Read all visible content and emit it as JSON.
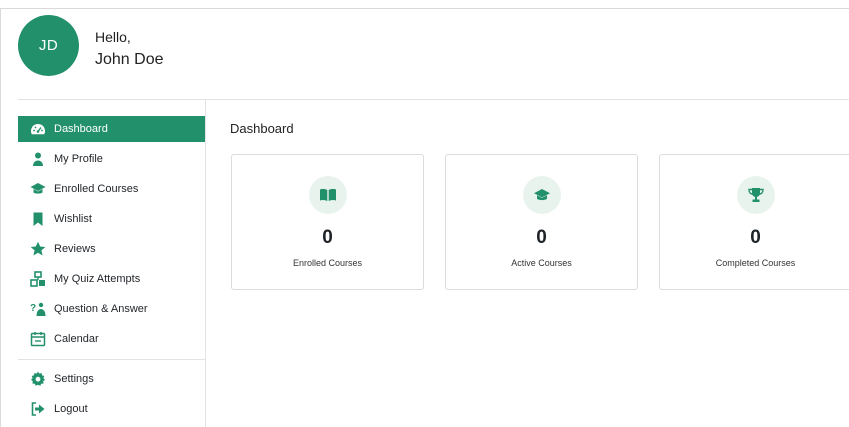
{
  "header": {
    "avatar_initials": "JD",
    "greeting": "Hello,",
    "user_name": "John Doe"
  },
  "sidebar": {
    "items": [
      {
        "label": "Dashboard",
        "icon": "dashboard-icon",
        "active": true
      },
      {
        "label": "My Profile",
        "icon": "user-icon"
      },
      {
        "label": "Enrolled Courses",
        "icon": "graduation-cap-icon"
      },
      {
        "label": "Wishlist",
        "icon": "bookmark-icon"
      },
      {
        "label": "Reviews",
        "icon": "star-icon"
      },
      {
        "label": "My Quiz Attempts",
        "icon": "quiz-icon"
      },
      {
        "label": "Question & Answer",
        "icon": "question-answer-icon"
      },
      {
        "label": "Calendar",
        "icon": "calendar-icon"
      },
      {
        "label": "Settings",
        "icon": "gear-icon"
      },
      {
        "label": "Logout",
        "icon": "logout-icon"
      }
    ]
  },
  "main": {
    "title": "Dashboard",
    "cards": [
      {
        "value": "0",
        "label": "Enrolled Courses",
        "icon": "book-open-icon"
      },
      {
        "value": "0",
        "label": "Active Courses",
        "icon": "graduation-cap-icon"
      },
      {
        "value": "0",
        "label": "Completed Courses",
        "icon": "trophy-icon"
      }
    ]
  },
  "colors": {
    "accent": "#22916b",
    "icon_bg": "#e8f3ee",
    "text": "#1f2328"
  }
}
